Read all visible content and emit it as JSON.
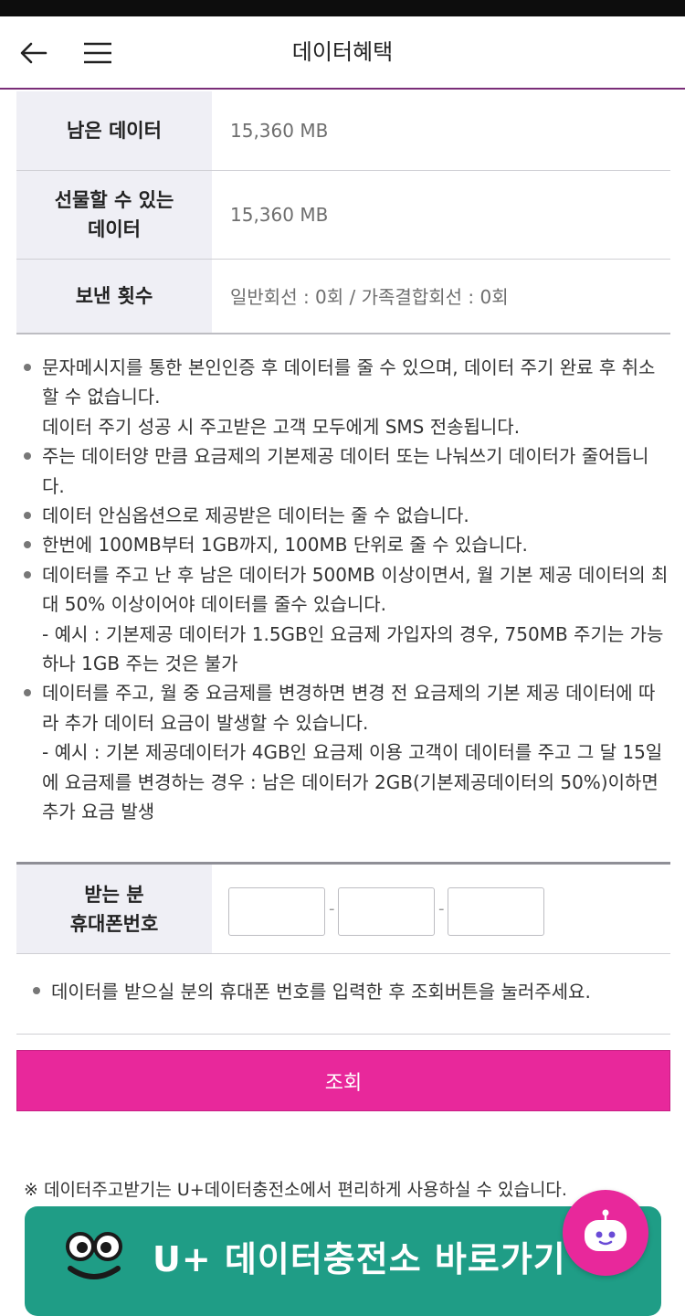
{
  "header": {
    "title": "데이터혜택",
    "back_icon": "arrow-left-icon",
    "menu_icon": "hamburger-menu-icon"
  },
  "info_table": {
    "rows": [
      {
        "label": "남은 데이터",
        "value": "15,360 MB"
      },
      {
        "label": "선물할 수 있는\n데이터",
        "value": "15,360 MB"
      },
      {
        "label": "보낸 횟수",
        "value": "일반회선 : 0회 / 가족결합회선 : 0회"
      }
    ]
  },
  "notes": [
    {
      "main": "문자메시지를 통한 본인인증 후 데이터를 줄 수 있으며, 데이터 주기 완료 후 취소할 수 없습니다.",
      "sub": "데이터 주기 성공 시 주고받은 고객 모두에게 SMS 전송됩니다."
    },
    {
      "main": "주는 데이터양 만큼 요금제의 기본제공 데이터 또는 나눠쓰기 데이터가 줄어듭니다.",
      "sub": ""
    },
    {
      "main": "데이터 안심옵션으로 제공받은 데이터는 줄 수 없습니다.",
      "sub": ""
    },
    {
      "main": "한번에 100MB부터 1GB까지, 100MB 단위로 줄 수 있습니다.",
      "sub": ""
    },
    {
      "main": "데이터를 주고 난 후 남은 데이터가 500MB 이상이면서, 월 기본 제공 데이터의 최대 50% 이상이어야 데이터를 줄수 있습니다.",
      "sub": "- 예시 : 기본제공 데이터가 1.5GB인 요금제 가입자의 경우, 750MB 주기는 가능하나 1GB 주는 것은 불가"
    },
    {
      "main": "데이터를 주고, 월 중 요금제를 변경하면 변경 전 요금제의 기본 제공 데이터에 따라 추가 데이터 요금이 발생할 수 있습니다.",
      "sub": "- 예시 : 기본 제공데이터가 4GB인 요금제 이용 고객이 데이터를 주고 그 달 15일에 요금제를 변경하는 경우 : 남은 데이터가 2GB(기본제공데이터의 50%)이하면 추가 요금 발생"
    }
  ],
  "recipient": {
    "label": "받는 분\n휴대폰번호",
    "phone_parts": [
      "",
      "",
      ""
    ],
    "separator": "-"
  },
  "hint": "데이터를 받으실 분의 휴대폰 번호를 입력한 후 조회버튼을 눌러주세요.",
  "search_button": "조회",
  "footnote": "※ 데이터주고받기는 U+데이터충전소에서 편리하게 사용하실 수 있습니다.",
  "charge_banner": {
    "text": "U+ 데이터충전소 바로가기",
    "mascot_icon": "mascot-eyes-icon"
  },
  "chatbot_icon": "chatbot-icon",
  "colors": {
    "accent_pink": "#e8289b",
    "banner_green": "#1f9d86",
    "header_line": "#7a2d78",
    "table_header_bg": "#efeff5"
  }
}
